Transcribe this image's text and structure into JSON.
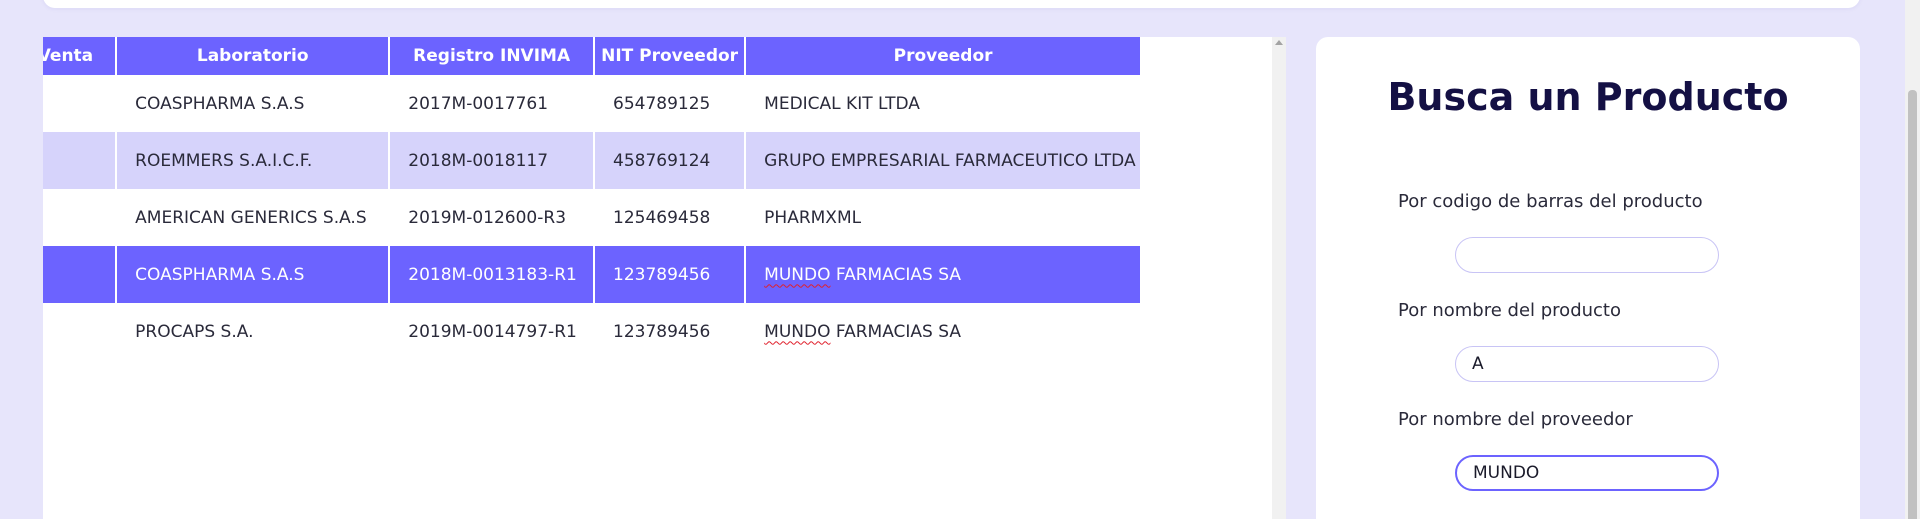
{
  "table": {
    "headers": {
      "sale": "Precio de Venta",
      "lab": "Laboratorio",
      "invima": "Registro INVIMA",
      "nit": "NIT Proveedor",
      "supplier": "Proveedor"
    },
    "rows": [
      {
        "lab": "COASPHARMA S.A.S",
        "invima": "2017M-0017761",
        "nit": "654789125",
        "supplier_a": "",
        "supplier_b": "MEDICAL KIT LTDA"
      },
      {
        "lab": "ROEMMERS S.A.I.C.F.",
        "invima": "2018M-0018117",
        "nit": "458769124",
        "supplier_a": "",
        "supplier_b": "GRUPO EMPRESARIAL FARMACEUTICO LTDA"
      },
      {
        "lab": "AMERICAN GENERICS S.A.S",
        "invima": "2019M-012600-R3",
        "nit": "125469458",
        "supplier_a": "",
        "supplier_b": "PHARMXML"
      },
      {
        "lab": "COASPHARMA S.A.S",
        "invima": "2018M-0013183-R1",
        "nit": "123789456",
        "supplier_a": "MUNDO",
        "supplier_b": " FARMACIAS SA"
      },
      {
        "lab": "PROCAPS S.A.",
        "invima": "2019M-0014797-R1",
        "nit": "123789456",
        "supplier_a": "MUNDO",
        "supplier_b": " FARMACIAS SA"
      }
    ],
    "selected_row": 3
  },
  "search": {
    "title": "Busca un Producto",
    "barcode_label": "Por codigo de barras del producto",
    "barcode_value": "",
    "name_label": "Por nombre del producto",
    "name_value": "A",
    "supplier_label": "Por nombre del proveedor",
    "supplier_value": "MUNDO"
  },
  "colors": {
    "accent": "#6c63ff",
    "row_alt": "#d6d3fb",
    "background": "#e7e5fb",
    "title": "#141044"
  }
}
